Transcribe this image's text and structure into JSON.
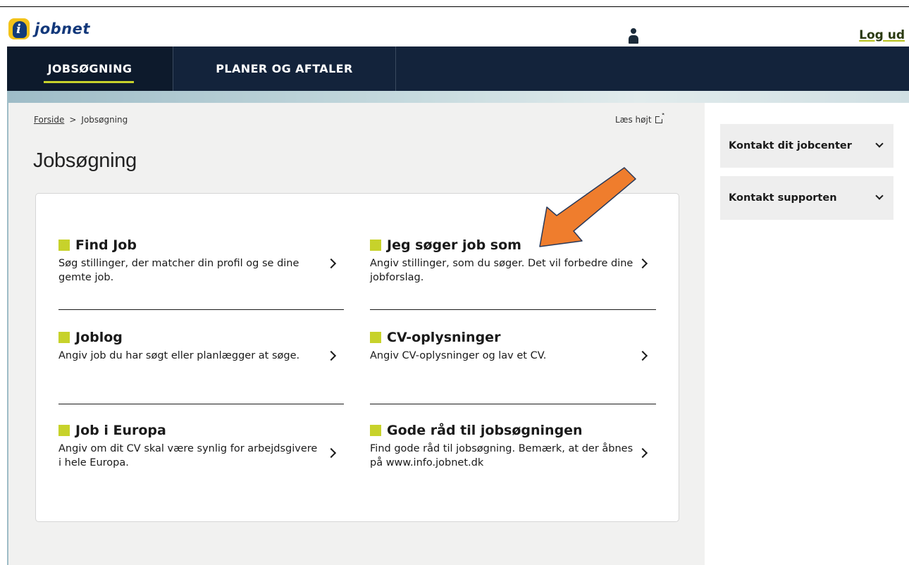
{
  "header": {
    "logo_text": "jobnet",
    "logout_label": "Log ud"
  },
  "nav": {
    "tabs": [
      {
        "label": "JOBSØGNING",
        "active": true
      },
      {
        "label": "PLANER OG AFTALER",
        "active": false
      }
    ]
  },
  "breadcrumb": {
    "home": "Forside",
    "separator": ">",
    "current": "Jobsøgning"
  },
  "read_aloud": "Læs højt",
  "page_title": "Jobsøgning",
  "items": [
    {
      "title": "Find Job",
      "description": "Søg stillinger, der matcher din profil og se dine gemte job."
    },
    {
      "title": "Jeg søger job som",
      "description": "Angiv stillinger, som du søger. Det vil forbedre dine jobforslag."
    },
    {
      "title": "Joblog",
      "description": "Angiv job du har søgt eller planlægger at søge."
    },
    {
      "title": "CV-oplysninger",
      "description": "Angiv CV-oplysninger og lav et CV."
    },
    {
      "title": "Job i Europa",
      "description": "Angiv om dit CV skal være synlig for arbejdsgivere i hele Europa."
    },
    {
      "title": "Gode råd til jobsøgningen",
      "description": "Find gode råd til jobsøgning. Bemærk, at der åbnes på www.info.jobnet.dk"
    }
  ],
  "sidebar": {
    "panels": [
      {
        "label": "Kontakt dit jobcenter"
      },
      {
        "label": "Kontakt supporten"
      }
    ]
  },
  "colors": {
    "nav_bg": "#13233b",
    "accent_green": "#c7d22b",
    "annotation_arrow": "#ef7d2d"
  },
  "icons": [
    "user-icon",
    "external-link-icon",
    "chevron-right-icon",
    "chevron-down-icon",
    "annotation-arrow"
  ]
}
